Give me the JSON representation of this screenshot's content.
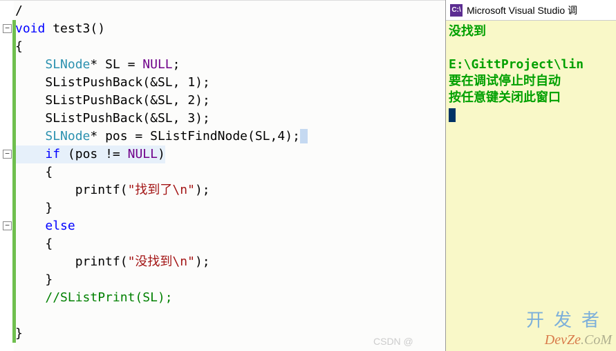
{
  "editor": {
    "collapse_glyph": "−",
    "lines": [
      {
        "indent": 0,
        "tokens": [
          {
            "t": "/",
            "c": "op"
          }
        ]
      },
      {
        "indent": 0,
        "tokens": [
          {
            "t": "void",
            "c": "kw"
          },
          {
            "t": " ",
            "c": "op"
          },
          {
            "t": "test3",
            "c": "funcname"
          },
          {
            "t": "()",
            "c": "op"
          }
        ]
      },
      {
        "indent": 0,
        "tokens": [
          {
            "t": "{",
            "c": "op"
          }
        ]
      },
      {
        "indent": 1,
        "tokens": [
          {
            "t": "SLNode",
            "c": "type"
          },
          {
            "t": "* ",
            "c": "op"
          },
          {
            "t": "SL",
            "c": "id"
          },
          {
            "t": " = ",
            "c": "op"
          },
          {
            "t": "NULL",
            "c": "null"
          },
          {
            "t": ";",
            "c": "op"
          }
        ]
      },
      {
        "indent": 1,
        "tokens": [
          {
            "t": "SListPushBack",
            "c": "func"
          },
          {
            "t": "(&",
            "c": "op"
          },
          {
            "t": "SL",
            "c": "id"
          },
          {
            "t": ", ",
            "c": "op"
          },
          {
            "t": "1",
            "c": "num"
          },
          {
            "t": ");",
            "c": "op"
          }
        ]
      },
      {
        "indent": 1,
        "tokens": [
          {
            "t": "SListPushBack",
            "c": "func"
          },
          {
            "t": "(&",
            "c": "op"
          },
          {
            "t": "SL",
            "c": "id"
          },
          {
            "t": ", ",
            "c": "op"
          },
          {
            "t": "2",
            "c": "num"
          },
          {
            "t": ");",
            "c": "op"
          }
        ]
      },
      {
        "indent": 1,
        "tokens": [
          {
            "t": "SListPushBack",
            "c": "func"
          },
          {
            "t": "(&",
            "c": "op"
          },
          {
            "t": "SL",
            "c": "id"
          },
          {
            "t": ", ",
            "c": "op"
          },
          {
            "t": "3",
            "c": "num"
          },
          {
            "t": ");",
            "c": "op"
          }
        ]
      },
      {
        "indent": 1,
        "tokens": [
          {
            "t": "SLNode",
            "c": "type"
          },
          {
            "t": "* ",
            "c": "op"
          },
          {
            "t": "pos",
            "c": "id"
          },
          {
            "t": " = ",
            "c": "op"
          },
          {
            "t": "SListFindNode",
            "c": "func"
          },
          {
            "t": "(",
            "c": "op"
          },
          {
            "t": "SL",
            "c": "id"
          },
          {
            "t": ",",
            "c": "op"
          },
          {
            "t": "4",
            "c": "num"
          },
          {
            "t": ")",
            "c": "op"
          },
          {
            "t": ";",
            "c": "op"
          },
          {
            "t": " ",
            "c": "sel-end"
          }
        ]
      },
      {
        "indent": 1,
        "hl": true,
        "tokens": [
          {
            "t": "if",
            "c": "kw"
          },
          {
            "t": " (",
            "c": "op"
          },
          {
            "t": "pos",
            "c": "id"
          },
          {
            "t": " != ",
            "c": "op"
          },
          {
            "t": "NULL",
            "c": "null"
          },
          {
            "t": ")",
            "c": "op"
          }
        ]
      },
      {
        "indent": 1,
        "tokens": [
          {
            "t": "{",
            "c": "op"
          }
        ]
      },
      {
        "indent": 2,
        "tokens": [
          {
            "t": "printf",
            "c": "func"
          },
          {
            "t": "(",
            "c": "op"
          },
          {
            "t": "\"找到了",
            "c": "str"
          },
          {
            "t": "\\n",
            "c": "esc"
          },
          {
            "t": "\"",
            "c": "str"
          },
          {
            "t": ");",
            "c": "op"
          }
        ]
      },
      {
        "indent": 1,
        "tokens": [
          {
            "t": "}",
            "c": "op"
          }
        ]
      },
      {
        "indent": 1,
        "tokens": [
          {
            "t": "else",
            "c": "kw"
          }
        ]
      },
      {
        "indent": 1,
        "tokens": [
          {
            "t": "{",
            "c": "op"
          }
        ]
      },
      {
        "indent": 2,
        "tokens": [
          {
            "t": "printf",
            "c": "func"
          },
          {
            "t": "(",
            "c": "op"
          },
          {
            "t": "\"没找到",
            "c": "str"
          },
          {
            "t": "\\n",
            "c": "esc"
          },
          {
            "t": "\"",
            "c": "str"
          },
          {
            "t": ");",
            "c": "op"
          }
        ]
      },
      {
        "indent": 1,
        "tokens": [
          {
            "t": "}",
            "c": "op"
          }
        ]
      },
      {
        "indent": 1,
        "tokens": [
          {
            "t": "//SListPrint(SL);",
            "c": "comment"
          }
        ]
      },
      {
        "indent": 0,
        "tokens": []
      },
      {
        "indent": 0,
        "tokens": [
          {
            "t": "}",
            "c": "op"
          }
        ]
      }
    ],
    "collapse_buttons": [
      1,
      8,
      12
    ],
    "change_bar": {
      "from_line": 1,
      "to_line": 18
    }
  },
  "console": {
    "titlebar_icon": "C:\\",
    "titlebar_text": "Microsoft Visual Studio 调",
    "output_lines": [
      "没找到",
      "",
      "E:\\GittProject\\lin",
      "要在调试停止时自动",
      "按任意键关闭此窗口"
    ]
  },
  "watermarks": {
    "top": "开发者",
    "brand": "DevZe",
    "suffix": ".CoM",
    "csdn": "CSDN @"
  }
}
